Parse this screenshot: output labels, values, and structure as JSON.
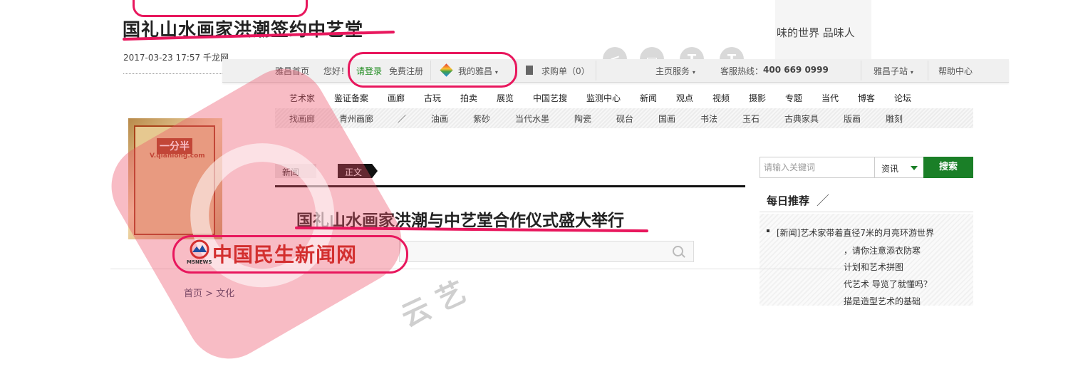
{
  "bg_article": {
    "title": "国礼山水画家洪潮签约中艺堂",
    "date": "2017-03-23 17:57",
    "source": "千龙网",
    "right_snippet": "味的世界 品味人",
    "thumb_text": "一分半",
    "thumb_url": "V.qianlong.com"
  },
  "topbar": {
    "home": "雅昌首页",
    "greeting": "您好！",
    "login": "请登录",
    "register": "免费注册",
    "my_artron": "我的雅昌",
    "caret": "▾",
    "purchase_list": "求购单（0）",
    "main_service": "主页服务",
    "hotline_label": "客服热线：",
    "hotline_number": "400 669 0999",
    "subsites": "雅昌子站",
    "help": "帮助中心"
  },
  "nav_primary": [
    "艺术家",
    "鉴证备案",
    "画廊",
    "古玩",
    "拍卖",
    "展览",
    "中国艺搜",
    "监测中心",
    "新闻",
    "观点",
    "视频",
    "摄影",
    "专题",
    "当代",
    "博客",
    "论坛"
  ],
  "nav_secondary": [
    "找画廊",
    "青州画廊",
    "／",
    "油画",
    "紫砂",
    "当代水墨",
    "陶瓷",
    "砚台",
    "国画",
    "书法",
    "玉石",
    "古典家具",
    "版画",
    "雕刻"
  ],
  "breadcrumb_tabs": {
    "news": "新闻",
    "body": "正文"
  },
  "article": {
    "title": "国礼山水画家洪潮与中艺堂合作仪式盛大举行"
  },
  "search": {
    "placeholder": "请输入关键词",
    "type": "资讯",
    "button": "搜索"
  },
  "recommend": {
    "title": "每日推荐",
    "slash": "／",
    "items": [
      "[新闻]艺术家带着直径7米的月亮环游世界",
      "，请你注意添衣防寒",
      "计划和艺术拼图",
      "代艺术  导览了就懂吗？",
      "描是造型艺术的基础"
    ]
  },
  "logo": {
    "text": "中国民生新闻网",
    "sub": "MSNEWS"
  },
  "lower": {
    "breadcrumb": "首页 > 文化",
    "watermark": "云  艺"
  }
}
